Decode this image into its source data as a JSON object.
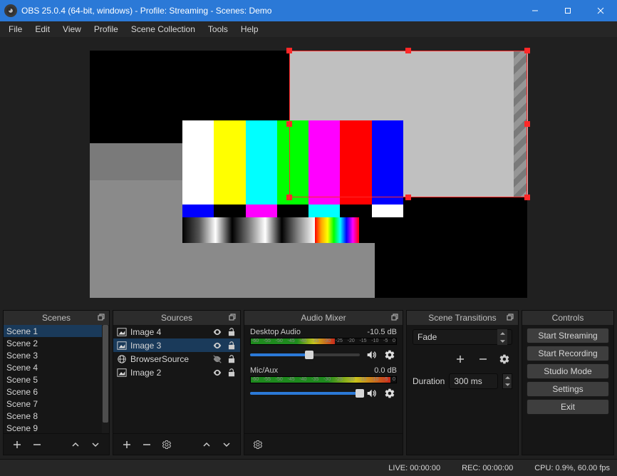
{
  "window": {
    "title": "OBS 25.0.4 (64-bit, windows) - Profile: Streaming - Scenes: Demo"
  },
  "menu": [
    "File",
    "Edit",
    "View",
    "Profile",
    "Scene Collection",
    "Tools",
    "Help"
  ],
  "panels": {
    "scenes": {
      "title": "Scenes",
      "items": [
        "Scene 1",
        "Scene 2",
        "Scene 3",
        "Scene 4",
        "Scene 5",
        "Scene 6",
        "Scene 7",
        "Scene 8",
        "Scene 9"
      ],
      "selected_index": 0
    },
    "sources": {
      "title": "Sources",
      "items": [
        {
          "label": "Image 4",
          "type": "image",
          "visible": true,
          "locked": false
        },
        {
          "label": "Image 3",
          "type": "image",
          "visible": true,
          "locked": false
        },
        {
          "label": "BrowserSource",
          "type": "browser",
          "visible": false,
          "locked": false
        },
        {
          "label": "Image 2",
          "type": "image",
          "visible": true,
          "locked": false
        }
      ],
      "selected_index": 1
    },
    "mixer": {
      "title": "Audio Mixer",
      "ticks": [
        "-60",
        "-55",
        "-50",
        "-45",
        "-40",
        "-35",
        "-30",
        "-25",
        "-20",
        "-15",
        "-10",
        "-5",
        "0"
      ],
      "channels": [
        {
          "name": "Desktop Audio",
          "db": "-10.5 dB",
          "fill_pct": 58,
          "slider_pct": 54
        },
        {
          "name": "Mic/Aux",
          "db": "0.0 dB",
          "fill_pct": 96,
          "slider_pct": 100
        }
      ]
    },
    "transitions": {
      "title": "Scene Transitions",
      "selected": "Fade",
      "duration_label": "Duration",
      "duration_value": "300 ms"
    },
    "controls": {
      "title": "Controls",
      "buttons": [
        "Start Streaming",
        "Start Recording",
        "Studio Mode",
        "Settings",
        "Exit"
      ]
    }
  },
  "status": {
    "live": "LIVE: 00:00:00",
    "rec": "REC: 00:00:00",
    "cpu": "CPU: 0.9%, 60.00 fps"
  }
}
